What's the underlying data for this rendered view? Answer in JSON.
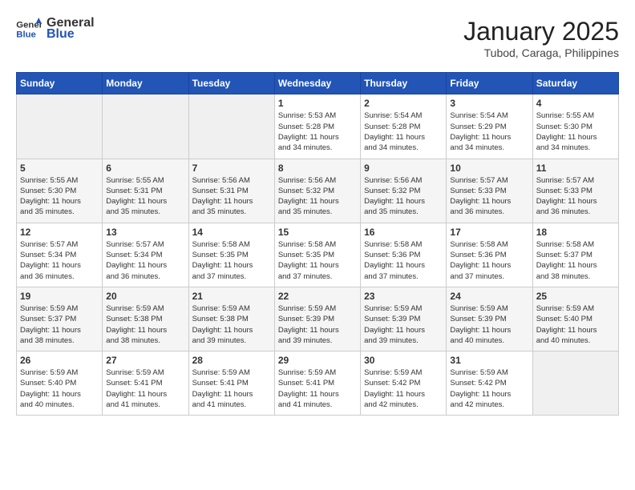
{
  "header": {
    "logo_line1": "General",
    "logo_line2": "Blue",
    "title": "January 2025",
    "subtitle": "Tubod, Caraga, Philippines"
  },
  "weekdays": [
    "Sunday",
    "Monday",
    "Tuesday",
    "Wednesday",
    "Thursday",
    "Friday",
    "Saturday"
  ],
  "weeks": [
    [
      {
        "day": "",
        "info": ""
      },
      {
        "day": "",
        "info": ""
      },
      {
        "day": "",
        "info": ""
      },
      {
        "day": "1",
        "info": "Sunrise: 5:53 AM\nSunset: 5:28 PM\nDaylight: 11 hours\nand 34 minutes."
      },
      {
        "day": "2",
        "info": "Sunrise: 5:54 AM\nSunset: 5:28 PM\nDaylight: 11 hours\nand 34 minutes."
      },
      {
        "day": "3",
        "info": "Sunrise: 5:54 AM\nSunset: 5:29 PM\nDaylight: 11 hours\nand 34 minutes."
      },
      {
        "day": "4",
        "info": "Sunrise: 5:55 AM\nSunset: 5:30 PM\nDaylight: 11 hours\nand 34 minutes."
      }
    ],
    [
      {
        "day": "5",
        "info": "Sunrise: 5:55 AM\nSunset: 5:30 PM\nDaylight: 11 hours\nand 35 minutes."
      },
      {
        "day": "6",
        "info": "Sunrise: 5:55 AM\nSunset: 5:31 PM\nDaylight: 11 hours\nand 35 minutes."
      },
      {
        "day": "7",
        "info": "Sunrise: 5:56 AM\nSunset: 5:31 PM\nDaylight: 11 hours\nand 35 minutes."
      },
      {
        "day": "8",
        "info": "Sunrise: 5:56 AM\nSunset: 5:32 PM\nDaylight: 11 hours\nand 35 minutes."
      },
      {
        "day": "9",
        "info": "Sunrise: 5:56 AM\nSunset: 5:32 PM\nDaylight: 11 hours\nand 35 minutes."
      },
      {
        "day": "10",
        "info": "Sunrise: 5:57 AM\nSunset: 5:33 PM\nDaylight: 11 hours\nand 36 minutes."
      },
      {
        "day": "11",
        "info": "Sunrise: 5:57 AM\nSunset: 5:33 PM\nDaylight: 11 hours\nand 36 minutes."
      }
    ],
    [
      {
        "day": "12",
        "info": "Sunrise: 5:57 AM\nSunset: 5:34 PM\nDaylight: 11 hours\nand 36 minutes."
      },
      {
        "day": "13",
        "info": "Sunrise: 5:57 AM\nSunset: 5:34 PM\nDaylight: 11 hours\nand 36 minutes."
      },
      {
        "day": "14",
        "info": "Sunrise: 5:58 AM\nSunset: 5:35 PM\nDaylight: 11 hours\nand 37 minutes."
      },
      {
        "day": "15",
        "info": "Sunrise: 5:58 AM\nSunset: 5:35 PM\nDaylight: 11 hours\nand 37 minutes."
      },
      {
        "day": "16",
        "info": "Sunrise: 5:58 AM\nSunset: 5:36 PM\nDaylight: 11 hours\nand 37 minutes."
      },
      {
        "day": "17",
        "info": "Sunrise: 5:58 AM\nSunset: 5:36 PM\nDaylight: 11 hours\nand 37 minutes."
      },
      {
        "day": "18",
        "info": "Sunrise: 5:58 AM\nSunset: 5:37 PM\nDaylight: 11 hours\nand 38 minutes."
      }
    ],
    [
      {
        "day": "19",
        "info": "Sunrise: 5:59 AM\nSunset: 5:37 PM\nDaylight: 11 hours\nand 38 minutes."
      },
      {
        "day": "20",
        "info": "Sunrise: 5:59 AM\nSunset: 5:38 PM\nDaylight: 11 hours\nand 38 minutes."
      },
      {
        "day": "21",
        "info": "Sunrise: 5:59 AM\nSunset: 5:38 PM\nDaylight: 11 hours\nand 39 minutes."
      },
      {
        "day": "22",
        "info": "Sunrise: 5:59 AM\nSunset: 5:39 PM\nDaylight: 11 hours\nand 39 minutes."
      },
      {
        "day": "23",
        "info": "Sunrise: 5:59 AM\nSunset: 5:39 PM\nDaylight: 11 hours\nand 39 minutes."
      },
      {
        "day": "24",
        "info": "Sunrise: 5:59 AM\nSunset: 5:39 PM\nDaylight: 11 hours\nand 40 minutes."
      },
      {
        "day": "25",
        "info": "Sunrise: 5:59 AM\nSunset: 5:40 PM\nDaylight: 11 hours\nand 40 minutes."
      }
    ],
    [
      {
        "day": "26",
        "info": "Sunrise: 5:59 AM\nSunset: 5:40 PM\nDaylight: 11 hours\nand 40 minutes."
      },
      {
        "day": "27",
        "info": "Sunrise: 5:59 AM\nSunset: 5:41 PM\nDaylight: 11 hours\nand 41 minutes."
      },
      {
        "day": "28",
        "info": "Sunrise: 5:59 AM\nSunset: 5:41 PM\nDaylight: 11 hours\nand 41 minutes."
      },
      {
        "day": "29",
        "info": "Sunrise: 5:59 AM\nSunset: 5:41 PM\nDaylight: 11 hours\nand 41 minutes."
      },
      {
        "day": "30",
        "info": "Sunrise: 5:59 AM\nSunset: 5:42 PM\nDaylight: 11 hours\nand 42 minutes."
      },
      {
        "day": "31",
        "info": "Sunrise: 5:59 AM\nSunset: 5:42 PM\nDaylight: 11 hours\nand 42 minutes."
      },
      {
        "day": "",
        "info": ""
      }
    ]
  ]
}
